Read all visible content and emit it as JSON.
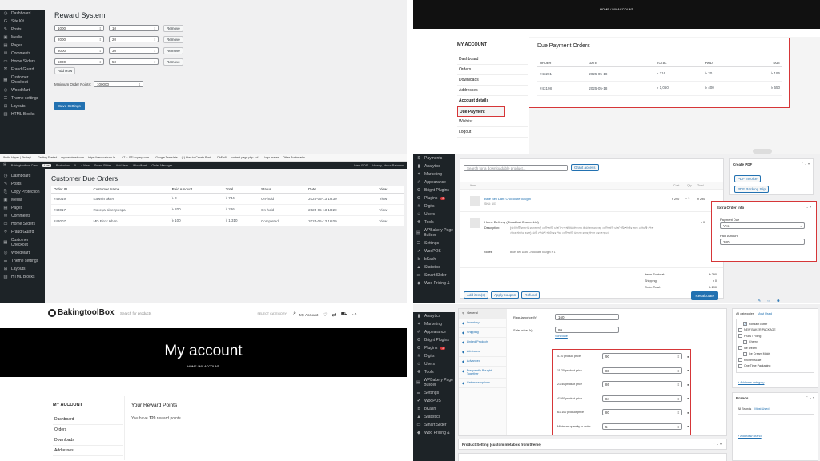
{
  "panel1": {
    "sidebar": [
      {
        "label": "Dashboard",
        "icon": "dashboard-icon"
      },
      {
        "label": "Site Kit",
        "icon": "sitekit-icon"
      },
      {
        "label": "Posts",
        "icon": "pin-icon"
      },
      {
        "label": "Media",
        "icon": "media-icon"
      },
      {
        "label": "Pages",
        "icon": "page-icon"
      },
      {
        "label": "Comments",
        "icon": "comment-icon"
      },
      {
        "label": "Home Sliders",
        "icon": "slider-icon"
      },
      {
        "label": "Fraud Guard",
        "icon": "shield-icon"
      },
      {
        "label": "Customer Checkout",
        "icon": "cart-icon"
      },
      {
        "label": "WoodMart",
        "icon": "woodmart-icon"
      },
      {
        "label": "Theme settings",
        "icon": "settings-icon"
      },
      {
        "label": "Layouts",
        "icon": "layouts-icon"
      },
      {
        "label": "HTML Blocks",
        "icon": "html-icon"
      }
    ],
    "title": "Reward System",
    "rows": [
      {
        "amount": "1000",
        "points": "10"
      },
      {
        "amount": "2000",
        "points": "20"
      },
      {
        "amount": "3000",
        "points": "30"
      },
      {
        "amount": "5000",
        "points": "50"
      }
    ],
    "remove_label": "Remove",
    "add_row_label": "Add Row",
    "min_label": "Minimum Order Points:",
    "min_value": "100000",
    "save_label": "Save Settings"
  },
  "panel2": {
    "breadcrumb": "HOME / MY ACCOUNT",
    "menu_title": "MY ACCOUNT",
    "menu": [
      "Dashboard",
      "Orders",
      "Downloads",
      "Addresses",
      "Account details",
      "Due Payment",
      "Wishlist",
      "Logout"
    ],
    "heading": "Due Payment Orders",
    "columns": [
      "ORDER",
      "DATE",
      "TOTAL",
      "PAID",
      "DUE"
    ],
    "orders": [
      {
        "order": "#43201",
        "date": "2025-05-18",
        "total": "৳ 216",
        "paid": "৳ 20",
        "due": "৳ 196"
      },
      {
        "order": "#43198",
        "date": "2025-05-18",
        "total": "৳ 1,050",
        "paid": "৳ 400",
        "due": "৳ 650"
      }
    ]
  },
  "panel3": {
    "bookmarks": [
      "White Hyper | Strategi...",
      "Getting Started",
      "mycostoisted.com",
      "https://www.rebuck.le...",
      "AT-A-STI superp.com...",
      "Google Translate",
      "(1) How to Create Post...",
      "DhFeAI",
      "content-page.php - cf...",
      "logo maker",
      "Other Bookmarks"
    ],
    "adminbar": [
      "Bakingtoolbox.Com",
      "Protection",
      "0",
      "+ New",
      "Smart Slider",
      "Add Item",
      "WoodMart",
      "Order Manager",
      "View POS",
      "Howdy, Abdur Rahman"
    ],
    "adminbar_badge": "Live",
    "sidebar": [
      {
        "label": "Dashboard",
        "icon": "dashboard-icon"
      },
      {
        "label": "Posts",
        "icon": "pin-icon"
      },
      {
        "label": "Copy Protection",
        "icon": "copy-icon"
      },
      {
        "label": "Media",
        "icon": "media-icon"
      },
      {
        "label": "Pages",
        "icon": "page-icon"
      },
      {
        "label": "Comments",
        "icon": "comment-icon"
      },
      {
        "label": "Home Sliders",
        "icon": "slider-icon"
      },
      {
        "label": "Fraud Guard",
        "icon": "shield-icon"
      },
      {
        "label": "Customer Checkout",
        "icon": "cart-icon"
      },
      {
        "label": "WoodMart",
        "icon": "woodmart-icon"
      },
      {
        "label": "Theme settings",
        "icon": "settings-icon"
      },
      {
        "label": "Layouts",
        "icon": "layouts-icon"
      },
      {
        "label": "HTML Blocks",
        "icon": "html-icon"
      }
    ],
    "title": "Customer Due Orders",
    "columns": [
      "Order ID",
      "Customer Name",
      "Paid Amount",
      "Total",
      "Status",
      "Date",
      "View"
    ],
    "rows": [
      {
        "id": "#43019",
        "name": "Kawsin akter",
        "paid": "৳ 0",
        "total": "৳ 744",
        "status": "On-hold",
        "date": "2025-05-13 19:30",
        "view": "View"
      },
      {
        "id": "#43017",
        "name": "Rokeya akter puspa",
        "paid": "৳ 200",
        "total": "৳ 286",
        "status": "On-hold",
        "date": "2025-05-13 18:20",
        "view": "View"
      },
      {
        "id": "#43007",
        "name": "MD Firoz Khan",
        "paid": "৳ 100",
        "total": "৳ 1,310",
        "status": "Completed",
        "date": "2025-05-13 16:09",
        "view": "View"
      }
    ]
  },
  "panel4": {
    "sidebar": [
      {
        "label": "Payments",
        "icon": "payments-icon"
      },
      {
        "label": "Analytics",
        "icon": "analytics-icon"
      },
      {
        "label": "Marketing",
        "icon": "marketing-icon"
      },
      {
        "label": "Appearance",
        "icon": "brush-icon"
      },
      {
        "label": "Bright Plugins",
        "icon": "plugin-icon"
      },
      {
        "label": "Plugins",
        "icon": "plugins-icon",
        "badge": "2"
      },
      {
        "label": "Digits",
        "icon": "digits-icon"
      },
      {
        "label": "Users",
        "icon": "users-icon"
      },
      {
        "label": "Tools",
        "icon": "tools-icon"
      },
      {
        "label": "WPBakery Page Builder",
        "icon": "builder-icon"
      },
      {
        "label": "Settings",
        "icon": "settings-icon"
      },
      {
        "label": "WooPOS",
        "icon": "pos-icon"
      },
      {
        "label": "bKash",
        "icon": "bkash-icon"
      },
      {
        "label": "Statistics",
        "icon": "stats-icon"
      },
      {
        "label": "Smart Slider",
        "icon": "slider-icon"
      },
      {
        "label": "Woo Pricing &",
        "icon": "pricing-icon"
      }
    ],
    "search_placeholder": "Search for a downloadable product...",
    "grant_label": "Grant access",
    "item_col": "Item",
    "cost_col": "Cost",
    "qty_col": "Qty",
    "total_col": "Total",
    "product_name": "Blue Bell Dark Chocolate 500gm",
    "product_sku": "SKU: 101",
    "product_cost": "৳ 290",
    "product_qty": "× 1",
    "product_total": "৳ 290",
    "delivery_name": "Home Delivery (Steadfast Courier Ltd)",
    "delivery_total": "৳ 0",
    "description_label": "Description:",
    "description_text": "(অর্ডারটি কনফার্ম করতে শুধু ডেলিভারি চার্জ ৳৭০ অগ্রিম প্রদানের প্রয়োজন রয়েছে। ডেলিভারি চার্জ পরিশোধের জন্য প্রোডাক্ট পেজ থেকে অর্ডার করুন) মোট পেমেন্ট অর্ডারের পরে ডেলিভারি ম্যানের কাছে প্রদান করতে হবে।",
    "notes_label": "Notes:",
    "notes_text": "Blue Bell Dark Chocolate 500gm × 1",
    "items_subtotal_label": "Items Subtotal:",
    "items_subtotal": "৳ 290",
    "shipping_label": "Shipping:",
    "shipping": "৳ 0",
    "order_total_label": "Order Total:",
    "order_total": "৳ 290",
    "add_items": "Add item(s)",
    "apply_coupon": "Apply coupon",
    "refund": "Refund",
    "recalculate": "Recalculate",
    "create_pdf": "Create PDF",
    "pdf_invoice": "PDF Invoice",
    "pdf_packing": "PDF Packing Slip",
    "extra_title": "Extra Order Info",
    "payment_due_label": "Payment Due",
    "payment_due_value": "Yes",
    "paid_amount_label": "Paid Amount",
    "paid_amount_value": "200"
  },
  "panel5": {
    "logo": "BakingtoolBox",
    "search_placeholder": "Search for products",
    "category": "SELECT CATEGORY",
    "my_account": "My Account",
    "cart_total": "৳ 0",
    "hero_title": "My account",
    "breadcrumb": "HOME / MY ACCOUNT",
    "menu_title": "MY ACCOUNT",
    "menu": [
      "Dashboard",
      "Orders",
      "Downloads",
      "Addresses"
    ],
    "heading": "Your Reward Points",
    "text_prefix": "You have ",
    "points": "120",
    "text_suffix": " reward points."
  },
  "panel6": {
    "sidebar": [
      {
        "label": "Analytics",
        "icon": "analytics-icon"
      },
      {
        "label": "Marketing",
        "icon": "marketing-icon"
      },
      {
        "label": "Appearance",
        "icon": "brush-icon"
      },
      {
        "label": "Bright Plugins",
        "icon": "plugin-icon"
      },
      {
        "label": "Plugins",
        "icon": "plugins-icon",
        "badge": "2"
      },
      {
        "label": "Digits",
        "icon": "digits-icon"
      },
      {
        "label": "Users",
        "icon": "users-icon"
      },
      {
        "label": "Tools",
        "icon": "tools-icon"
      },
      {
        "label": "WPBakery Page Builder",
        "icon": "builder-icon"
      },
      {
        "label": "Settings",
        "icon": "settings-icon"
      },
      {
        "label": "WooPOS",
        "icon": "pos-icon"
      },
      {
        "label": "bKash",
        "icon": "bkash-icon"
      },
      {
        "label": "Statistics",
        "icon": "stats-icon"
      },
      {
        "label": "Smart Slider",
        "icon": "slider-icon"
      },
      {
        "label": "Woo Pricing &",
        "icon": "pricing-icon"
      }
    ],
    "tabs": [
      "General",
      "Inventory",
      "Shipping",
      "Linked Products",
      "Attributes",
      "Advanced",
      "Frequently Bought Together",
      "Get more options"
    ],
    "regular_label": "Regular price (৳)",
    "regular_value": "160",
    "sale_label": "Sale price (৳)",
    "sale_value": "99",
    "schedule": "Schedule",
    "tiers": [
      {
        "label": "5-10 product price",
        "value": "90"
      },
      {
        "label": "11-20 product price",
        "value": "88"
      },
      {
        "label": "21-40 product price",
        "value": "86"
      },
      {
        "label": "41-60 product price",
        "value": "84"
      },
      {
        "label": "61-100 product price",
        "value": "80"
      },
      {
        "label": "Minimum quantity to order",
        "value": "5"
      }
    ],
    "product_setting": "Product Setting (custom metabox from theme)",
    "cat_tabs": [
      "All categories",
      "Most Used"
    ],
    "categories": [
      {
        "label": "Fondant cutter",
        "checked": true
      },
      {
        "label": "NEW BAKER PACKAGE",
        "checked": false
      },
      {
        "label": "Fruits / Filling",
        "checked": false
      },
      {
        "label": "Cherry",
        "checked": false
      },
      {
        "label": "Ice cream",
        "checked": false
      },
      {
        "label": "Ice Cream Molds",
        "checked": false
      },
      {
        "label": "Kitchen scale",
        "checked": false
      },
      {
        "label": "One Time Packaging",
        "checked": false
      }
    ],
    "add_category": "+ Add new category",
    "brands_title": "Brands",
    "brand_tabs": [
      "All Brands",
      "Most Used"
    ],
    "add_brand": "+ Add New Brand"
  }
}
